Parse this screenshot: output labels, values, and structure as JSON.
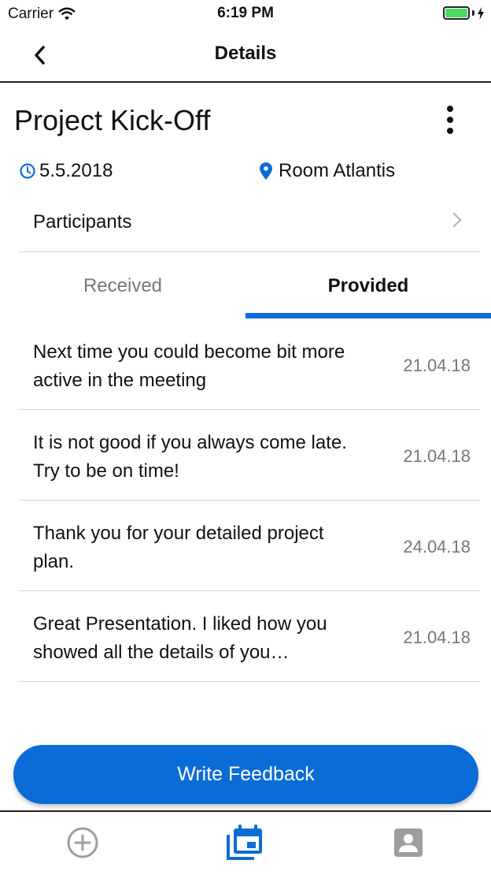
{
  "status_bar": {
    "carrier": "Carrier",
    "time": "6:19 PM"
  },
  "nav": {
    "title": "Details"
  },
  "event": {
    "title": "Project Kick-Off",
    "date": "5.5.2018",
    "location": "Room Atlantis",
    "participants_label": "Participants"
  },
  "tabs": [
    {
      "label": "Received",
      "selected": false
    },
    {
      "label": "Provided",
      "selected": true
    }
  ],
  "feedback": [
    {
      "text": "Next time you could become bit more active in the meeting",
      "date": "21.04.18"
    },
    {
      "text": "It is not good if you always come late. Try to be on time!",
      "date": "21.04.18"
    },
    {
      "text": "Thank you for your detailed project plan.",
      "date": "24.04.18"
    },
    {
      "text": "Great Presentation. I liked how you showed all the details of you…",
      "date": "21.04.18"
    }
  ],
  "cta": {
    "label": "Write Feedback"
  },
  "tab_bar": {
    "items": [
      "add-icon",
      "calendar-icon",
      "profile-icon"
    ],
    "active": "calendar-icon"
  },
  "colors": {
    "accent": "#0a6cd6",
    "battery": "#4cd964",
    "muted": "#777777"
  }
}
